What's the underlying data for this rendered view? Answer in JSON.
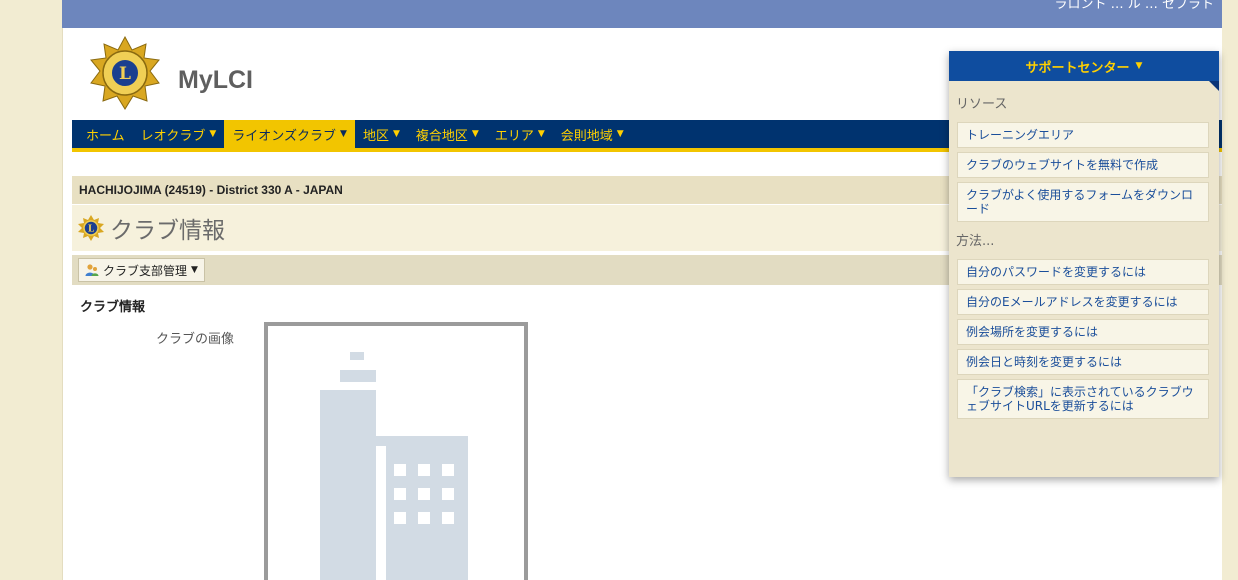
{
  "header": {
    "top_links": "ラロント … ル … セブラト",
    "brand": "MyLCI"
  },
  "nav": {
    "items": [
      {
        "label": "ホーム",
        "has_caret": false,
        "active": false
      },
      {
        "label": "レオクラブ",
        "has_caret": true,
        "active": false
      },
      {
        "label": "ライオンズクラブ",
        "has_caret": true,
        "active": true
      },
      {
        "label": "地区",
        "has_caret": true,
        "active": false
      },
      {
        "label": "複合地区",
        "has_caret": true,
        "active": false
      },
      {
        "label": "エリア",
        "has_caret": true,
        "active": false
      },
      {
        "label": "会則地域",
        "has_caret": true,
        "active": false
      }
    ],
    "caret_glyph": "▼"
  },
  "breadcrumb": "HACHIJOJIMA (24519) - District 330 A - JAPAN",
  "page_title": "クラブ情報",
  "toolbar": {
    "button_label": "クラブ支部管理",
    "caret": "▼"
  },
  "content": {
    "section_title": "クラブ情報",
    "image_label": "クラブの画像"
  },
  "support_center": {
    "header_label": "サポートセンター",
    "header_caret": "▼",
    "resources_heading": "リソース",
    "resources": [
      "トレーニングエリア",
      "クラブのウェブサイトを無料で作成",
      "クラブがよく使用するフォームをダウンロード"
    ],
    "howto_heading": "方法...",
    "howto": [
      "自分のパスワードを変更するには",
      "自分のEメールアドレスを変更するには",
      "例会場所を変更するには",
      "例会日と時刻を変更するには",
      "「クラブ検索」に表示されているクラブウェブサイトURLを更新するには"
    ]
  },
  "colors": {
    "nav_bg": "#00336f",
    "nav_text": "#ffd000",
    "nav_active_bg": "#f2c500",
    "support_header_bg": "#0f4d9f",
    "link": "#1a4e9a",
    "placeholder_icon": "#d2dbe4"
  },
  "icons": {
    "logo": "lions-logo-icon",
    "title": "lions-logo-icon",
    "toolbar": "people-icon",
    "placeholder": "building-placeholder-icon"
  }
}
